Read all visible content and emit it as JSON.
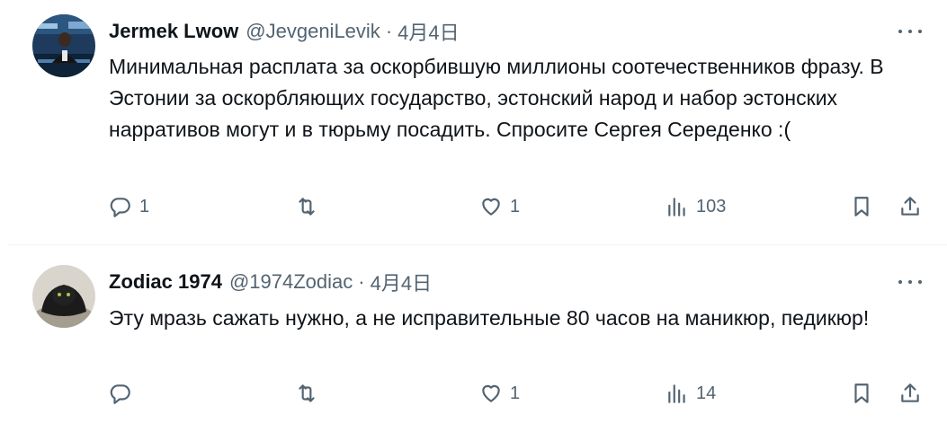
{
  "tweets": [
    {
      "name": "Jermek Lwow",
      "handle": "@JevgeniLevik",
      "separator": "·",
      "date": "4月4日",
      "text": "Минимальная расплата за оскорбившую миллионы соотечественников фразу. В Эстонии за оскорбляющих государство, эстонский народ и набор эстонских нарративов могут и в тюрьму посадить. Спросите Сергея Середенко :(",
      "replies": "1",
      "retweets": "",
      "likes": "1",
      "views": "103"
    },
    {
      "name": "Zodiac 1974",
      "handle": "@1974Zodiac",
      "separator": "·",
      "date": "4月4日",
      "text": "Эту мразь сажать нужно, а не исправительные 80 часов на маникюр, педикюр!",
      "replies": "",
      "retweets": "",
      "likes": "1",
      "views": "14"
    }
  ],
  "icons": {
    "reply": "reply-icon",
    "retweet": "retweet-icon",
    "like": "heart-icon",
    "views": "views-icon",
    "bookmark": "bookmark-icon",
    "share": "share-icon",
    "more": "more-icon"
  },
  "colors": {
    "text": "#0f1419",
    "secondary": "#536471",
    "divider": "#eff3f4"
  }
}
